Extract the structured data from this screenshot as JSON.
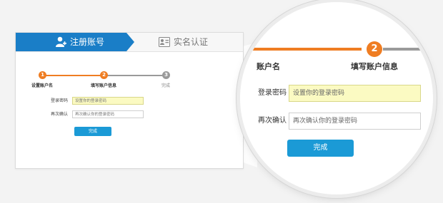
{
  "tabs": [
    {
      "label": "注册账号",
      "icon": "add-user-icon",
      "active": true
    },
    {
      "label": "实名认证",
      "icon": "id-card-icon",
      "active": false
    }
  ],
  "steps": [
    {
      "number": "1",
      "label": "设置账户名"
    },
    {
      "number": "2",
      "label": "填写账户信息"
    },
    {
      "number": "3",
      "label": "完成"
    }
  ],
  "form": {
    "password_label": "登录密码",
    "password_placeholder": "设置你的登录密码",
    "confirm_label": "再次确认",
    "confirm_placeholder": "再次确认你的登录密码",
    "submit_label": "完成"
  },
  "zoom": {
    "step1_partial": "账户名",
    "step2_number": "2",
    "step2_label": "填写账户信息",
    "password_label": "登录密码",
    "password_placeholder": "设置你的登录密码",
    "confirm_label": "再次确认",
    "confirm_placeholder": "再次确认你的登录密码",
    "submit_label": "完成"
  },
  "colors": {
    "primary": "#1a7ec7",
    "button": "#1b9ad6",
    "step_active": "#ef7d22",
    "step_inactive": "#9a9a9a",
    "highlight": "#fbfac2"
  }
}
